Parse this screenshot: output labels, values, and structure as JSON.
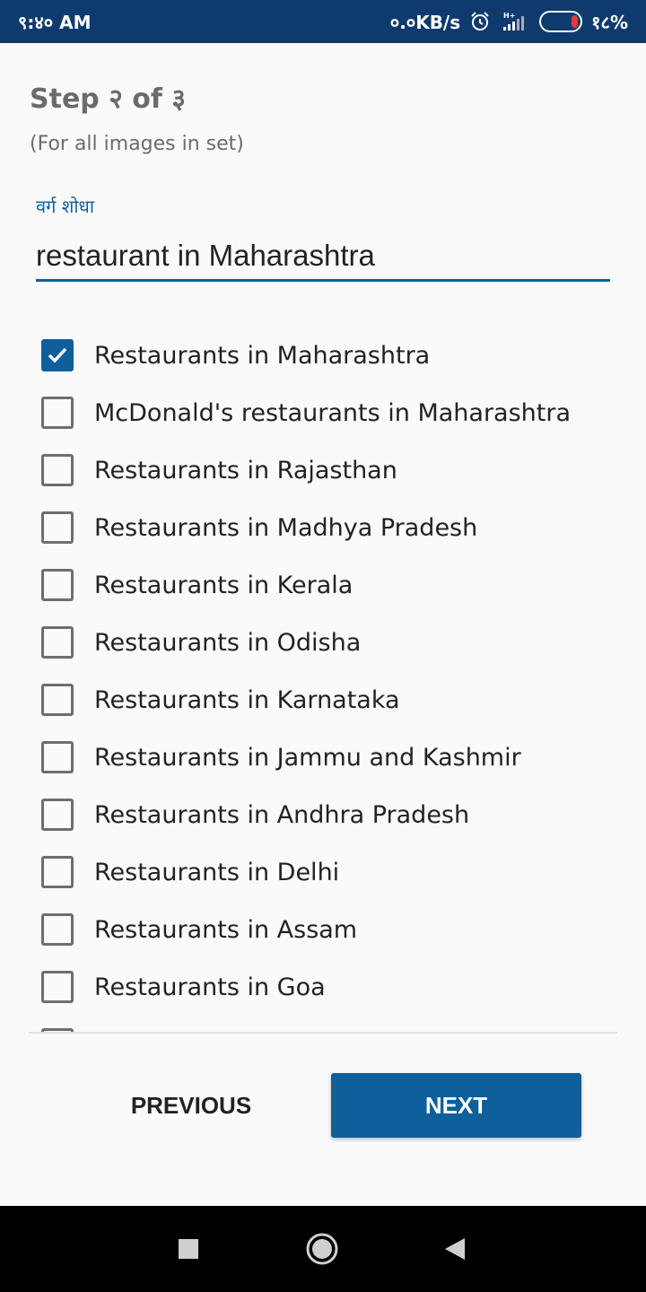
{
  "status_bar": {
    "time": "९:४० AM",
    "net_speed": "०.०KB/s",
    "battery_text": "१८%",
    "battery_level": 0.18,
    "icons": [
      "alarm-icon",
      "signal-icon",
      "battery-icon"
    ]
  },
  "header": {
    "title": "Step २ of ३",
    "subtitle": "(For all images in set)"
  },
  "search": {
    "label": "वर्ग शोधा",
    "value": "restaurant in Maharashtra"
  },
  "results": [
    {
      "label": "Restaurants in Maharashtra",
      "checked": true
    },
    {
      "label": "McDonald's restaurants in Maharashtra",
      "checked": false
    },
    {
      "label": "Restaurants in Rajasthan",
      "checked": false
    },
    {
      "label": "Restaurants in Madhya Pradesh",
      "checked": false
    },
    {
      "label": "Restaurants in Kerala",
      "checked": false
    },
    {
      "label": "Restaurants in Odisha",
      "checked": false
    },
    {
      "label": "Restaurants in Karnataka",
      "checked": false
    },
    {
      "label": "Restaurants in Jammu and Kashmir",
      "checked": false
    },
    {
      "label": "Restaurants in Andhra Pradesh",
      "checked": false
    },
    {
      "label": "Restaurants in Delhi",
      "checked": false
    },
    {
      "label": "Restaurants in Assam",
      "checked": false
    },
    {
      "label": "Restaurants in Goa",
      "checked": false
    }
  ],
  "buttons": {
    "previous": "PREVIOUS",
    "next": "NEXT"
  },
  "colors": {
    "status_bar": "#0e3a6e",
    "accent": "#0e5f9b",
    "battery_low": "#e53935"
  },
  "nav_bar": {
    "icons": [
      "recents-square-icon",
      "home-circle-icon",
      "back-triangle-icon"
    ]
  }
}
